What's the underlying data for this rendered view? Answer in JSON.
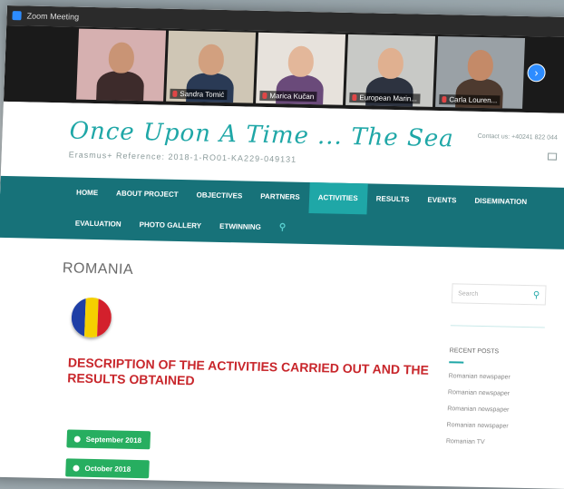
{
  "zoom": {
    "title": "Zoom Meeting"
  },
  "participants": [
    {
      "name": "",
      "skin": "#c99475",
      "shirt": "#3d2b2b",
      "bg": "#d6b0b0"
    },
    {
      "name": "Sandra Tomić",
      "skin": "#d2a07f",
      "shirt": "#2a3a55",
      "bg": "#cfc6b5"
    },
    {
      "name": "Marica Kučan",
      "skin": "#e3b79a",
      "shirt": "#6a4a7a",
      "bg": "#e7e2dc"
    },
    {
      "name": "European Marin...",
      "skin": "#e0b090",
      "shirt": "#2d3340",
      "bg": "#c8c9c6"
    },
    {
      "name": "Carla Louren...",
      "skin": "#c48a68",
      "shirt": "#4d3a2f",
      "bg": "#9aa1a6"
    }
  ],
  "next_label": "›",
  "site": {
    "title": "Once Upon A Time ... The Sea",
    "reference": "Erasmus+ Reference: 2018-1-RO01-KA229-049131",
    "contact": "Contact us: +40241 822 044"
  },
  "nav": {
    "row1": [
      "HOME",
      "ABOUT PROJECT",
      "OBJECTIVES",
      "PARTNERS",
      "ACTIVITIES",
      "RESULTS",
      "EVENTS",
      "DISEMINATION"
    ],
    "row2": [
      "EVALUATION",
      "PHOTO GALLERY",
      "ETWINNING"
    ],
    "active": "ACTIVITIES",
    "search_glyph": "⚲"
  },
  "page": {
    "heading": "ROMANIA",
    "flag_colors": [
      "#1f3fa6",
      "#f5d000",
      "#d3202c"
    ],
    "description": "DESCRIPTION OF THE ACTIVITIES CARRIED OUT AND THE RESULTS OBTAINED",
    "buttons": [
      "September 2018",
      "October 2018"
    ]
  },
  "sidebar": {
    "search_placeholder": "Search",
    "search_glyph": "⚲",
    "recent_title": "RECENT POSTS",
    "posts": [
      "Romanian newspaper",
      "Romanian newspaper",
      "Romanian newspaper",
      "Romanian newspaper",
      "Romanian TV"
    ]
  }
}
